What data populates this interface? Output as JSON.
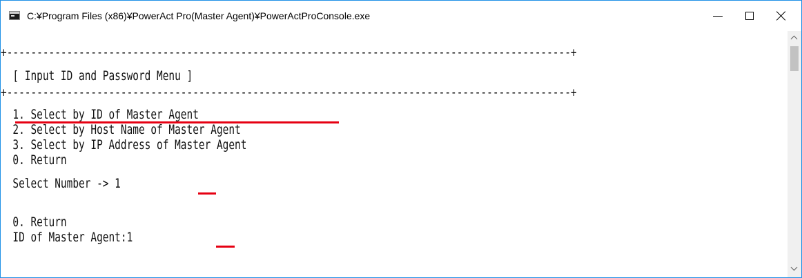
{
  "window": {
    "title": "C:¥Program Files (x86)¥PowerAct Pro(Master Agent)¥PowerActProConsole.exe",
    "app_icon": "console-app-icon",
    "controls": {
      "minimize_icon": "minimize-icon",
      "maximize_icon": "maximize-icon",
      "close_icon": "close-icon"
    }
  },
  "console": {
    "border_top": "+----------------------------------------------------------------------------------------------+",
    "menu_title": "  [ Input ID and Password Menu ]",
    "border_bottom": "+----------------------------------------------------------------------------------------------+",
    "options": [
      "  1. Select by ID of Master Agent",
      "  2. Select by Host Name of Master Agent",
      "  3. Select by IP Address of Master Agent",
      "  0. Return"
    ],
    "prompt": "  Select Number -> 1",
    "return_option": "  0. Return",
    "id_prompt": "  ID of Master Agent:1"
  },
  "annotation_color": "#e60012",
  "scrollbar": {
    "up_icon": "scroll-up-arrow-icon",
    "down_icon": "scroll-down-arrow-icon"
  }
}
